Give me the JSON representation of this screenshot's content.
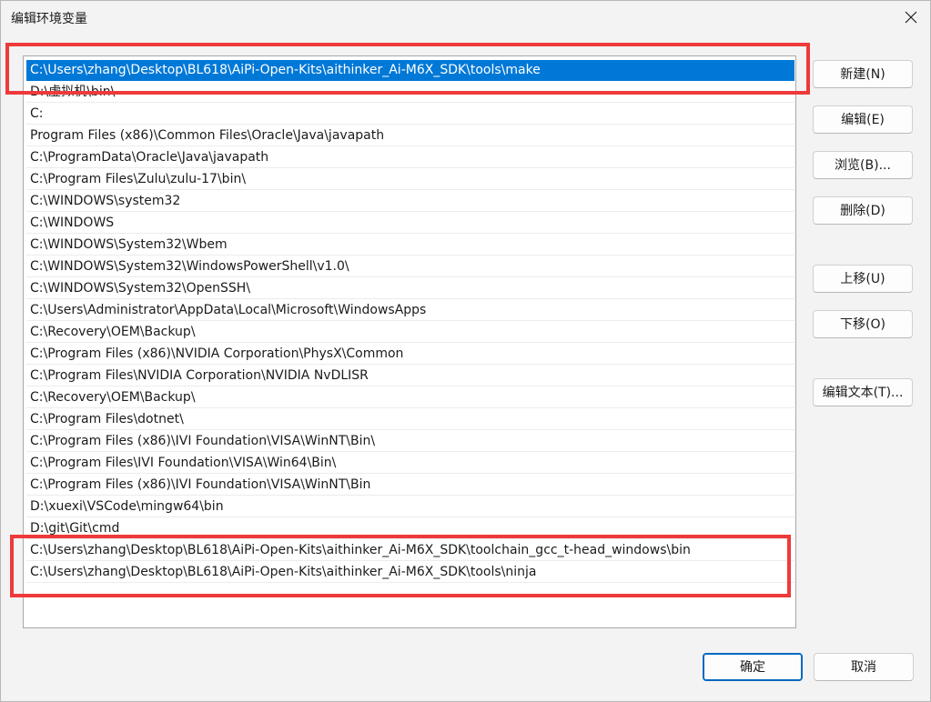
{
  "window": {
    "title": "编辑环境变量"
  },
  "paths": [
    "C:\\Users\\zhang\\Desktop\\BL618\\AiPi-Open-Kits\\aithinker_Ai-M6X_SDK\\tools\\make",
    "D:\\虚拟机\\bin\\",
    "C:",
    "Program Files (x86)\\Common Files\\Oracle\\Java\\javapath",
    "C:\\ProgramData\\Oracle\\Java\\javapath",
    "C:\\Program Files\\Zulu\\zulu-17\\bin\\",
    "C:\\WINDOWS\\system32",
    "C:\\WINDOWS",
    "C:\\WINDOWS\\System32\\Wbem",
    "C:\\WINDOWS\\System32\\WindowsPowerShell\\v1.0\\",
    "C:\\WINDOWS\\System32\\OpenSSH\\",
    "C:\\Users\\Administrator\\AppData\\Local\\Microsoft\\WindowsApps",
    "C:\\Recovery\\OEM\\Backup\\",
    "C:\\Program Files (x86)\\NVIDIA Corporation\\PhysX\\Common",
    "C:\\Program Files\\NVIDIA Corporation\\NVIDIA NvDLISR",
    "C:\\Recovery\\OEM\\Backup\\",
    "C:\\Program Files\\dotnet\\",
    "C:\\Program Files (x86)\\IVI Foundation\\VISA\\WinNT\\Bin\\",
    "C:\\Program Files\\IVI Foundation\\VISA\\Win64\\Bin\\",
    "C:\\Program Files (x86)\\IVI Foundation\\VISA\\WinNT\\Bin",
    "D:\\xuexi\\VSCode\\mingw64\\bin",
    "D:\\git\\Git\\cmd",
    "C:\\Users\\zhang\\Desktop\\BL618\\AiPi-Open-Kits\\aithinker_Ai-M6X_SDK\\toolchain_gcc_t-head_windows\\bin",
    "C:\\Users\\zhang\\Desktop\\BL618\\AiPi-Open-Kits\\aithinker_Ai-M6X_SDK\\tools\\ninja"
  ],
  "selected_index": 0,
  "buttons": {
    "new": "新建(N)",
    "edit": "编辑(E)",
    "browse": "浏览(B)...",
    "delete": "删除(D)",
    "move_up": "上移(U)",
    "move_down": "下移(O)",
    "edit_text": "编辑文本(T)...",
    "ok": "确定",
    "cancel": "取消"
  },
  "colors": {
    "selection": "#0078d7",
    "annotation": "#ee3a3a",
    "dialog_bg": "#f3f3f3"
  },
  "icons": {
    "close": "close-icon"
  }
}
